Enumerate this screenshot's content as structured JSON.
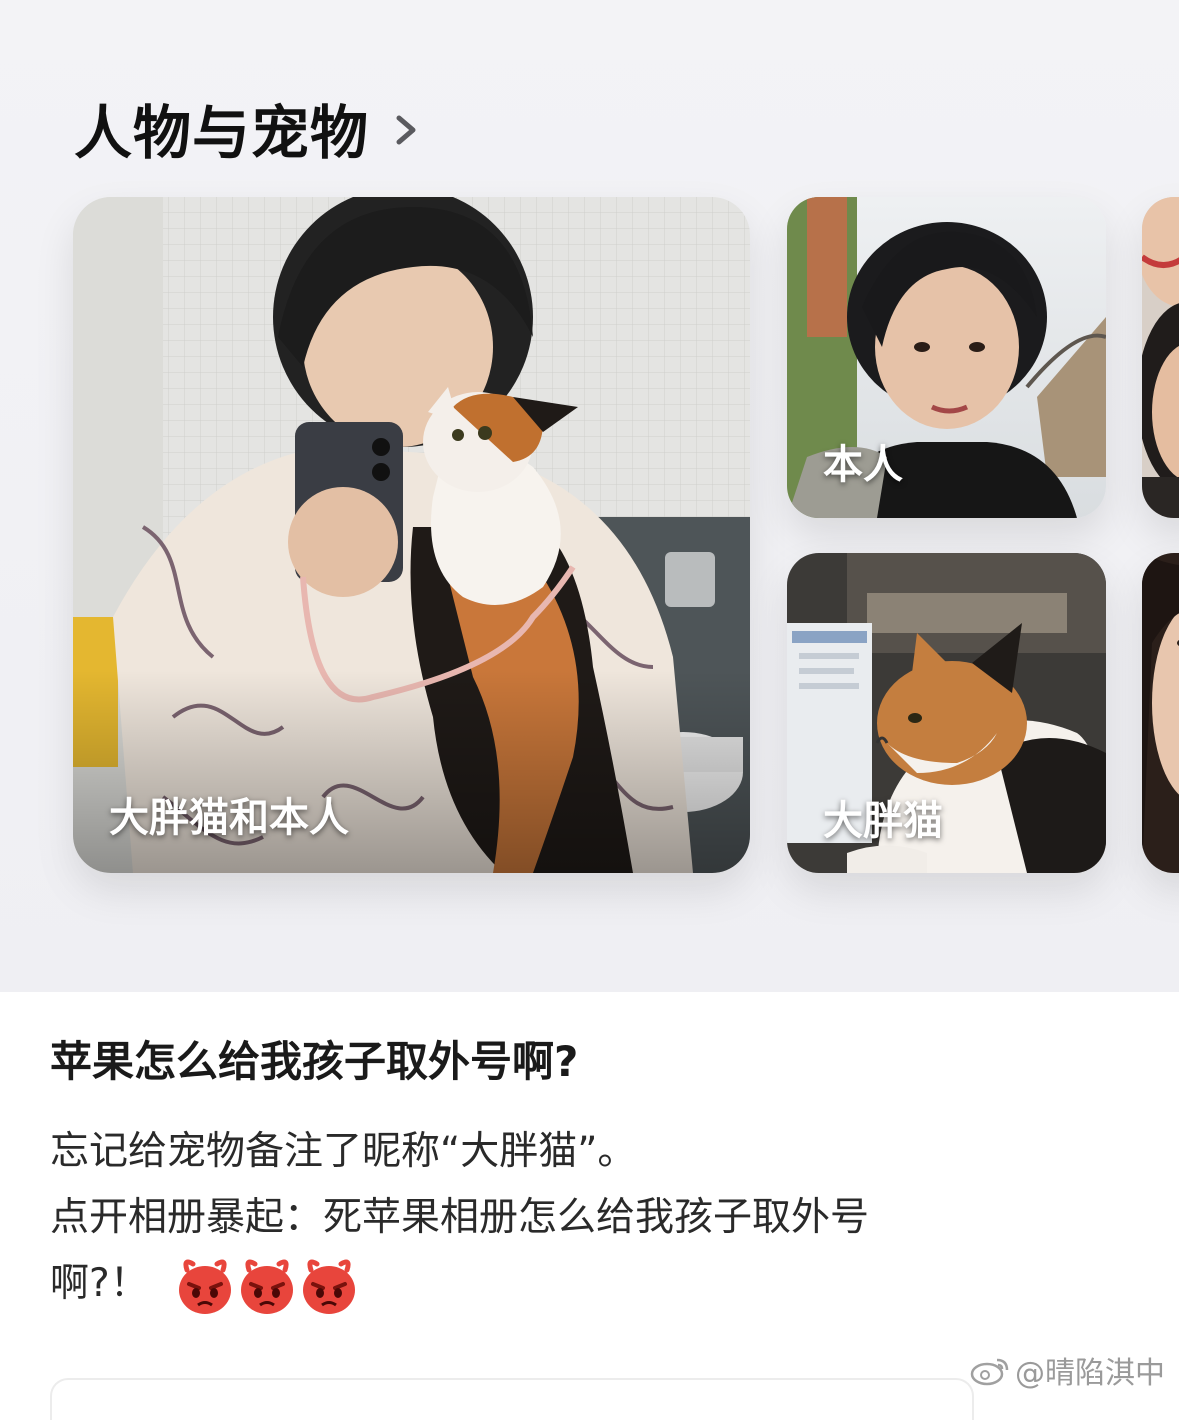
{
  "section": {
    "title": "人物与宠物"
  },
  "cards": {
    "main_label": "大胖猫和本人",
    "self_label": "本人",
    "cat_label": "大胖猫"
  },
  "post": {
    "title": "苹果怎么给我孩子取外号啊?",
    "line1": "忘记给宠物备注了昵称“大胖猫”。",
    "line2": "点开相册暴起：死苹果相册怎么给我孩子取外号",
    "line3": "啊?！"
  },
  "watermark": {
    "text": "@晴陷淇中"
  },
  "colors": {
    "accent_red": "#e8453c",
    "section_bg": "#f0f0f4",
    "title_text": "#111111"
  },
  "icons": {
    "chevron": "chevron-right-icon",
    "emoji": "angry-face-icon",
    "weibo": "weibo-logo-icon"
  }
}
